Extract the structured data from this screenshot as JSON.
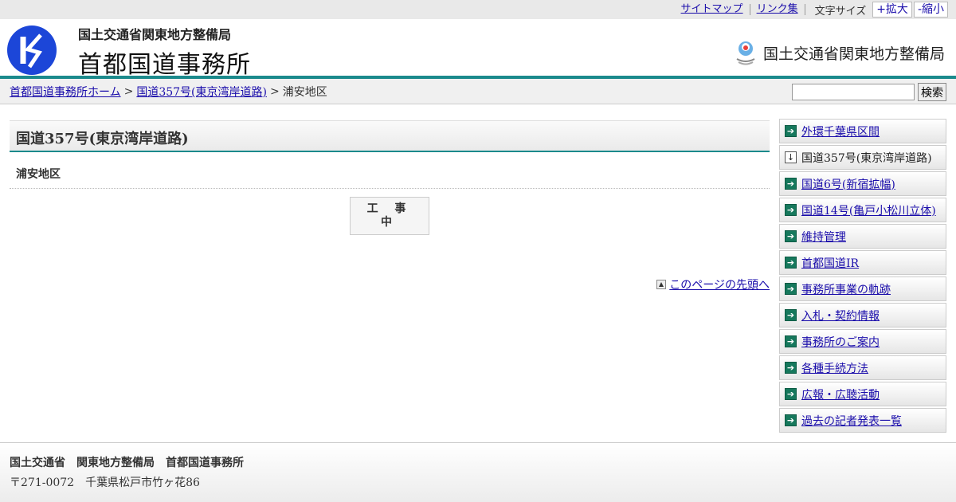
{
  "util": {
    "sitemap": "サイトマップ",
    "links": "リンク集",
    "font_size_label": "文字サイズ",
    "enlarge": "+拡大",
    "shrink": "-縮小"
  },
  "header": {
    "org_small": "国土交通省関東地方整備局",
    "org_big": "首都国道事務所",
    "mlit_text": "国土交通省関東地方整備局"
  },
  "breadcrumb": {
    "home": "首都国道事務所ホーム",
    "route": "国道357号(東京湾岸道路)",
    "current": "浦安地区",
    "sep": ">"
  },
  "search": {
    "button": "検索",
    "value": ""
  },
  "main": {
    "title": "国道357号(東京湾岸道路)",
    "subtitle": "浦安地区",
    "construction_line1": "工 事",
    "construction_line2": "中",
    "page_top": "このページの先頭へ"
  },
  "sidebar": {
    "items": [
      {
        "label": "外環千葉県区間",
        "current": false
      },
      {
        "label": "国道357号(東京湾岸道路)",
        "current": true
      },
      {
        "label": "国道6号(新宿拡幅)",
        "current": false
      },
      {
        "label": "国道14号(亀戸小松川立体)",
        "current": false
      },
      {
        "label": "維持管理",
        "current": false
      },
      {
        "label": "首都国道IR",
        "current": false
      },
      {
        "label": "事務所事業の軌跡",
        "current": false
      },
      {
        "label": "入札・契約情報",
        "current": false
      },
      {
        "label": "事務所のご案内",
        "current": false
      },
      {
        "label": "各種手続方法",
        "current": false
      },
      {
        "label": "広報・広聴活動",
        "current": false
      },
      {
        "label": "過去の記者発表一覧",
        "current": false
      }
    ]
  },
  "footer": {
    "line1": "国土交通省　関東地方整備局　首都国道事務所",
    "line2": "〒271-0072　千葉県松戸市竹ヶ花86"
  },
  "colors": {
    "accent": "#1b8a8c",
    "logo_blue": "#1c46d8",
    "arrow_green": "#16785c"
  }
}
